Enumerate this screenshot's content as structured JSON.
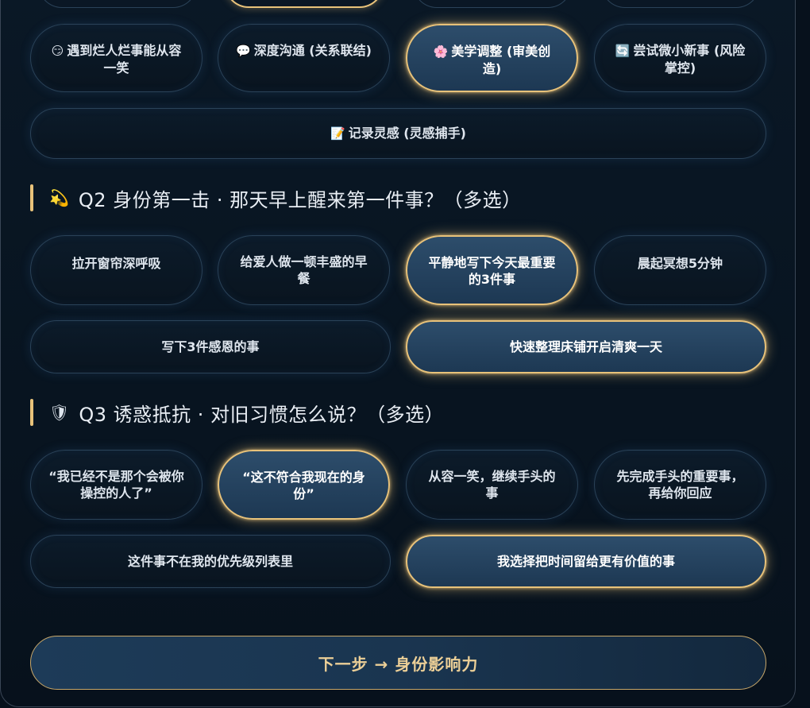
{
  "q1": {
    "options": [
      {
        "icon": "😏",
        "icon_name": "smirk-face-icon",
        "label": "遇到烂人烂事能从容一笑",
        "selected": false
      },
      {
        "icon": "💬",
        "icon_name": "speech-bubble-icon",
        "label": "深度沟通 (关系联结)",
        "selected": false
      },
      {
        "icon": "🌸",
        "icon_name": "flower-icon",
        "label": "美学调整 (审美创造)",
        "selected": true
      },
      {
        "icon": "🔄",
        "icon_name": "refresh-icon",
        "label": "尝试微小新事 (风险掌控)",
        "selected": false
      },
      {
        "icon": "📝",
        "icon_name": "memo-icon",
        "label": "记录灵感 (灵感捕手)",
        "selected": false
      }
    ]
  },
  "q2": {
    "icon": "💫",
    "icon_name": "dizzy-star-icon",
    "title": "Q2 身份第一击 · 那天早上醒来第一件事？（多选）",
    "options": [
      {
        "label": "拉开窗帘深呼吸",
        "selected": false
      },
      {
        "label": "给爱人做一顿丰盛的早餐",
        "selected": false
      },
      {
        "label": "平静地写下今天最重要的3件事",
        "selected": true
      },
      {
        "label": "晨起冥想5分钟",
        "selected": false
      },
      {
        "label": "写下3件感恩的事",
        "selected": false
      },
      {
        "label": "快速整理床铺开启清爽一天",
        "selected": true
      }
    ]
  },
  "q3": {
    "icon": "🛡",
    "icon_name": "shield-icon",
    "title": "Q3 诱惑抵抗 · 对旧习惯怎么说？（多选）",
    "options": [
      {
        "label": "“我已经不是那个会被你操控的人了”",
        "selected": false
      },
      {
        "label": "“这不符合我现在的身份”",
        "selected": true
      },
      {
        "label": "从容一笑，继续手头的事",
        "selected": false
      },
      {
        "label": "先完成手头的重要事，再给你回应",
        "selected": false
      },
      {
        "label": "这件事不在我的优先级列表里",
        "selected": false
      },
      {
        "label": "我选择把时间留给更有价值的事",
        "selected": true
      }
    ]
  },
  "next_button": {
    "label": "下一步 → 身份影响力"
  },
  "colors": {
    "accent": "#e8c27a",
    "selected_bg": "#2d4d6b",
    "bg": "#07111c"
  }
}
